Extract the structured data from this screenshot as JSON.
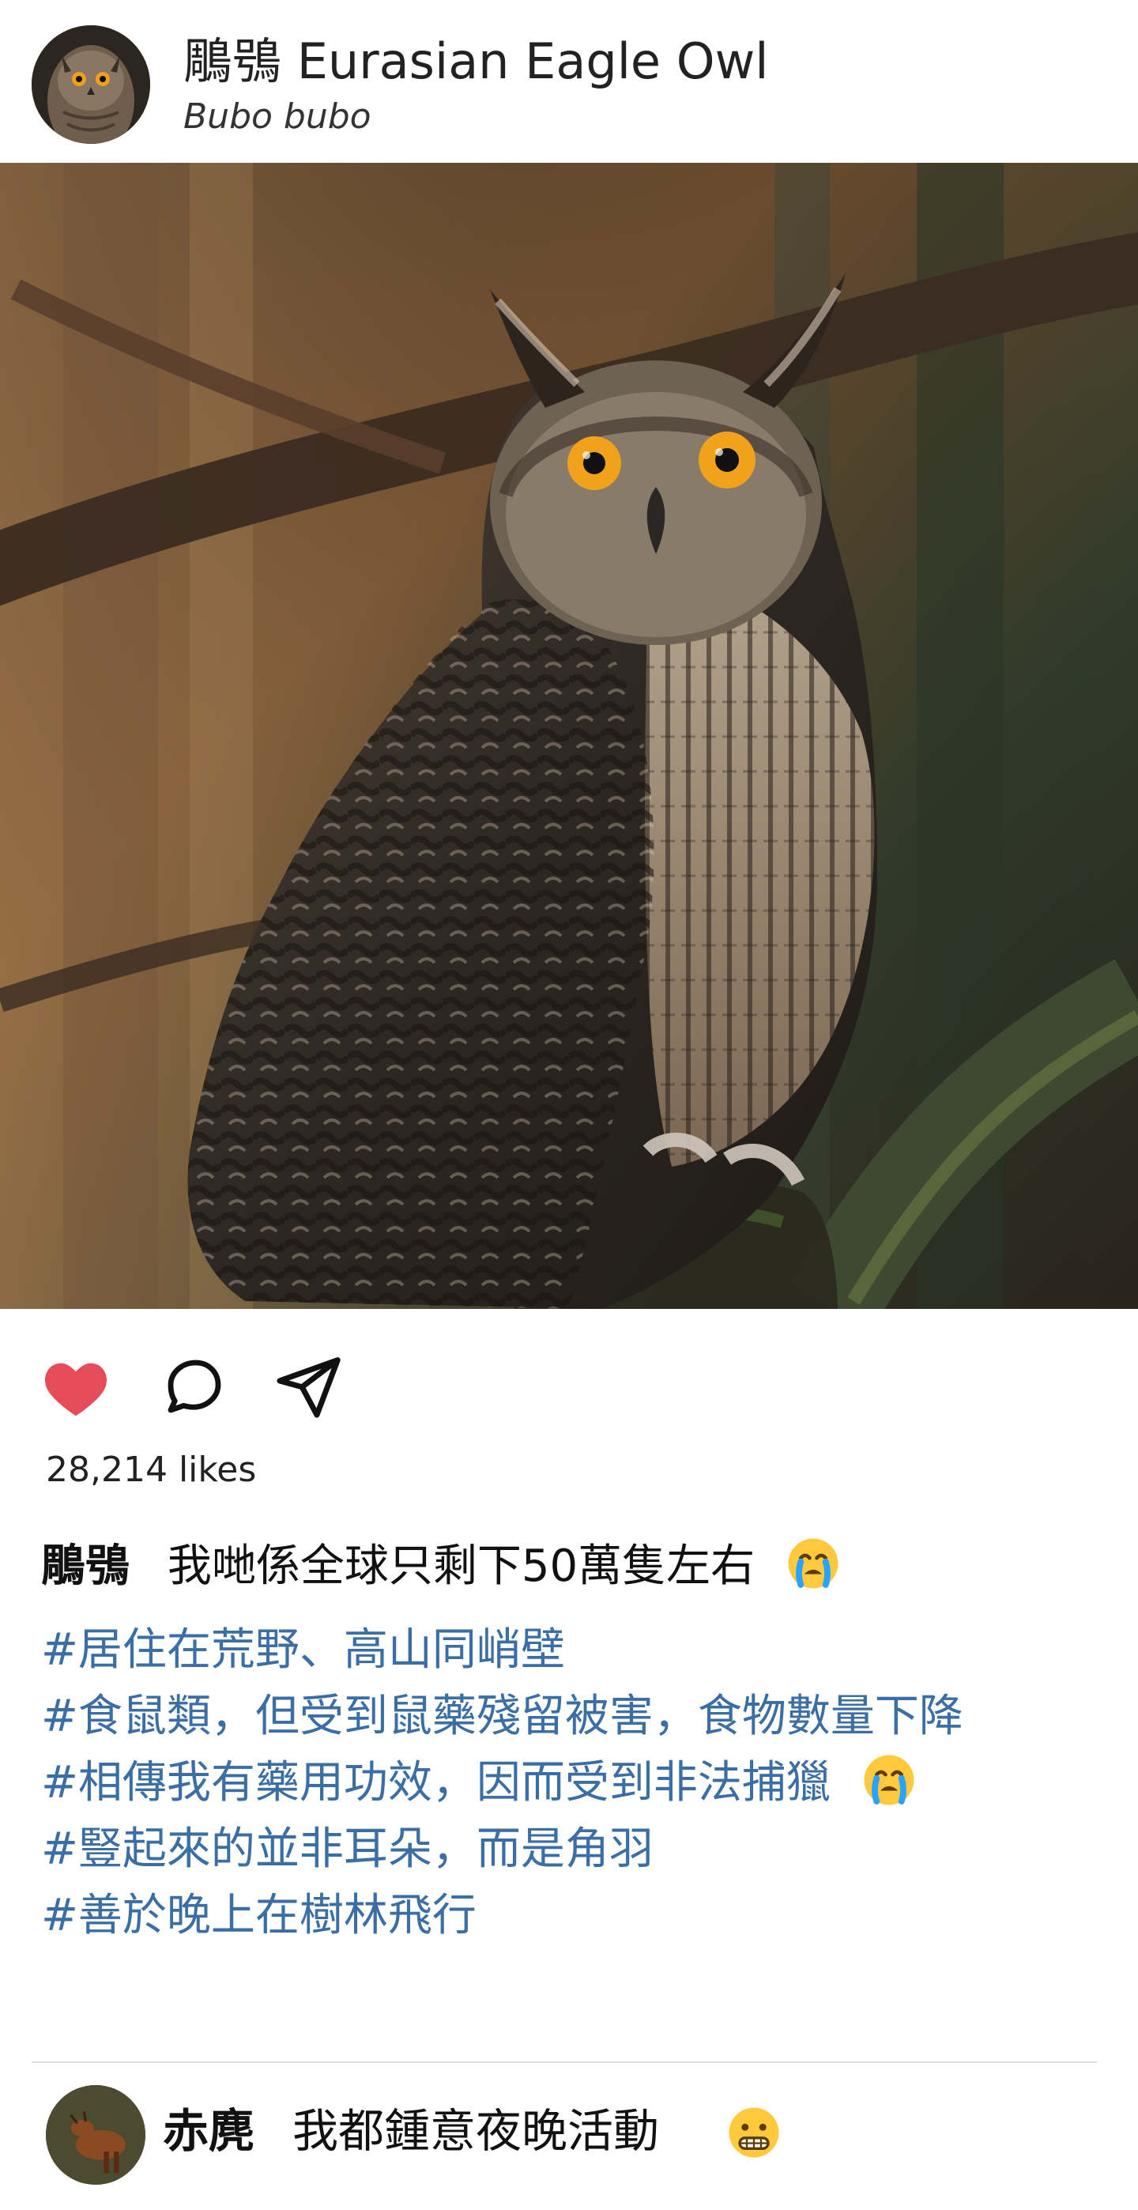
{
  "header": {
    "title": "鵰鴞 Eurasian Eagle Owl",
    "subtitle": "Bubo bubo",
    "avatar_icon": "owl-avatar-icon"
  },
  "post": {
    "likes_text": "28,214 likes",
    "liked": true,
    "heart_color": "#e74b5a",
    "caption": {
      "user": "鵰鴞",
      "text": "我哋係全球只剩下50萬隻左右"
    },
    "hashtags": [
      "#居住在荒野、高山同峭壁",
      "#食鼠類，但受到鼠藥殘留被害，食物數量下降",
      "#相傳我有藥用功效，因而受到非法捕獵",
      "#豎起來的並非耳朵，而是角羽",
      "#善於晚上在樹林飛行"
    ],
    "hashtag_color": "#3a6ea5"
  },
  "comment": {
    "user": "赤麂",
    "text": "我都鍾意夜晚活動",
    "avatar_icon": "muntjac-avatar-icon",
    "emoji": "grimacing-face-emoji"
  }
}
